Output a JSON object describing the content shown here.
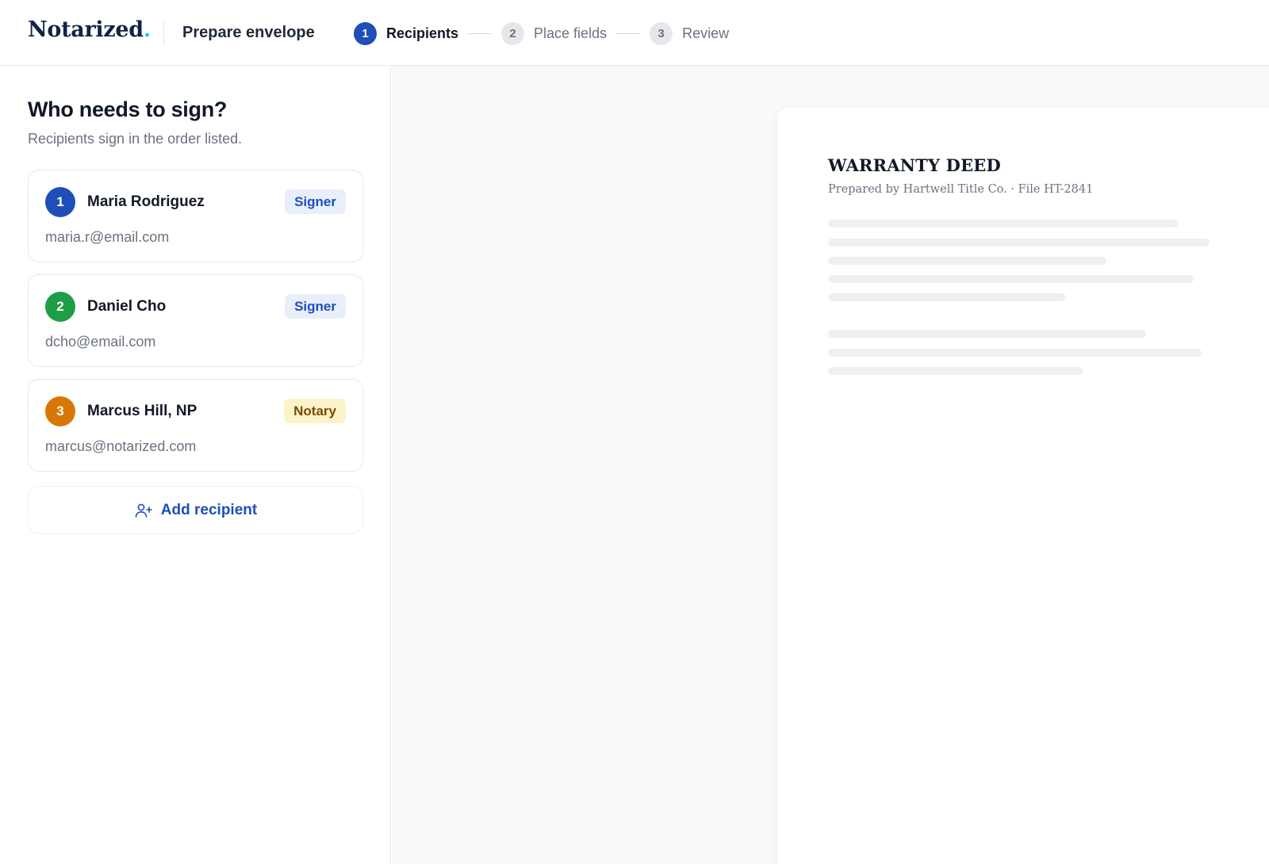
{
  "header": {
    "brand": "Notarized",
    "brand_dot": ".",
    "title": "Prepare envelope",
    "steps": [
      {
        "number": "1",
        "label": "Recipients",
        "active": true
      },
      {
        "number": "2",
        "label": "Place fields",
        "active": false
      },
      {
        "number": "3",
        "label": "Review",
        "active": false
      }
    ]
  },
  "sidebar": {
    "heading": "Who needs to sign?",
    "subheading": "Recipients sign in the order listed.",
    "recipients": [
      {
        "order": "1",
        "name": "Maria Rodriguez",
        "email": "maria.r@email.com",
        "role": "Signer",
        "color": "#1e4fb8"
      },
      {
        "order": "2",
        "name": "Daniel Cho",
        "email": "dcho@email.com",
        "role": "Signer",
        "color": "#1f9d47"
      },
      {
        "order": "3",
        "name": "Marcus Hill, NP",
        "email": "marcus@notarized.com",
        "role": "Notary",
        "color": "#d97706"
      }
    ],
    "add_label": "Add recipient"
  },
  "document": {
    "title": "WARRANTY DEED",
    "subtitle": "Prepared by Hartwell Title Co. · File HT-2841"
  },
  "colors": {
    "accent": "#1e4fb8",
    "signer_badge_bg": "#e8effb",
    "signer_badge_text": "#1e4fb8",
    "notary_badge_bg": "#fdf3c9",
    "notary_badge_text": "#7a4a05",
    "brand_dot": "#38bdf8"
  },
  "icons": {
    "add_recipient": "user-plus-icon"
  }
}
